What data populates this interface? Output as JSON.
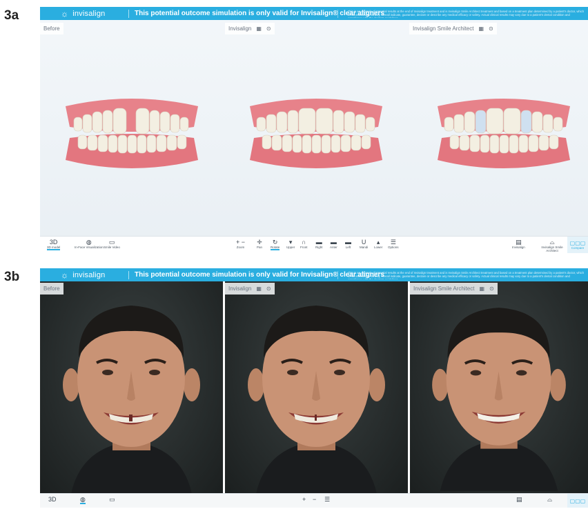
{
  "figure_labels": {
    "a": "3a",
    "b": "3b"
  },
  "banner": {
    "brand": "invisalign",
    "message": "This potential outcome simulation is only valid for Invisalign® clear aligners",
    "disclaimer": "This is an example of potential results at the end of Invisalign treatment and is Invisalign Smile Architect treatment and based on a treatment plan determined by a patient's doctor, which is not intended to convey, overall indicate, guarantee, declare or describe any medical efficacy or safety. Actual clinical results may vary due to a patient's dental condition and compliance with the doctor's guidelines."
  },
  "panel_a": {
    "views": [
      {
        "label": "Before",
        "icons": []
      },
      {
        "label": "Invisalign",
        "icons": [
          "model-icon",
          "info-icon"
        ]
      },
      {
        "label": "Invisalign Smile Architect",
        "icons": [
          "model-icon",
          "info-icon"
        ]
      }
    ],
    "left_tools": [
      {
        "icon": "3d-icon",
        "glyph": "3D",
        "label": "3D model",
        "active": true
      },
      {
        "icon": "globe-icon",
        "glyph": "◍",
        "label": "In-Face Visualization",
        "active": false
      },
      {
        "icon": "video-icon",
        "glyph": "▭",
        "label": "Smile Video",
        "active": false
      }
    ],
    "center_tools": [
      {
        "icon": "zoom-icon",
        "glyph": "+ −",
        "label": "Zoom"
      },
      {
        "icon": "pan-icon",
        "glyph": "✛",
        "label": "Pan"
      },
      {
        "icon": "rotate-icon",
        "glyph": "↻",
        "label": "Rotate"
      },
      {
        "icon": "upper-icon",
        "glyph": "▾",
        "label": "Upper"
      },
      {
        "icon": "front-icon",
        "glyph": "∩",
        "label": "Front"
      },
      {
        "icon": "right-icon",
        "glyph": "▬",
        "label": "Right"
      },
      {
        "icon": "anterior-icon",
        "glyph": "▬",
        "label": "Anter"
      },
      {
        "icon": "left-icon",
        "glyph": "▬",
        "label": "Left"
      },
      {
        "icon": "mandible-icon",
        "glyph": "U",
        "label": "Mandi"
      },
      {
        "icon": "lower-icon",
        "glyph": "▴",
        "label": "Lower"
      },
      {
        "icon": "options-icon",
        "glyph": "☰",
        "label": "Options"
      }
    ],
    "right_tools": [
      {
        "icon": "invisalign-icon",
        "glyph": "▤",
        "label": "Invisalign"
      },
      {
        "icon": "smile-architect-icon",
        "glyph": "⌓",
        "label": "Invisalign Smile Architect"
      }
    ],
    "compare": {
      "icon": "compare-icon",
      "glyph": "▢▢▢",
      "label": "Compare"
    }
  },
  "panel_b": {
    "views": [
      {
        "label": "Before",
        "icons": []
      },
      {
        "label": "Invisalign",
        "icons": [
          "model-icon",
          "info-icon"
        ]
      },
      {
        "label": "Invisalign Smile Architect",
        "icons": [
          "model-icon",
          "info-icon"
        ]
      }
    ],
    "left_tools": [
      {
        "icon": "3d-icon",
        "glyph": "3D"
      },
      {
        "icon": "globe-icon",
        "glyph": "◍"
      },
      {
        "icon": "video-icon",
        "glyph": "▭"
      }
    ],
    "center_tools": [
      {
        "icon": "zoom-in-icon",
        "glyph": "+"
      },
      {
        "icon": "zoom-out-icon",
        "glyph": "−"
      },
      {
        "icon": "options-icon",
        "glyph": "☰"
      }
    ],
    "right_tools": [
      {
        "icon": "invisalign-icon",
        "glyph": "▤"
      },
      {
        "icon": "smile-architect-icon",
        "glyph": "⌓"
      }
    ],
    "compare": {
      "icon": "compare-icon",
      "glyph": "▢▢▢"
    }
  },
  "colors": {
    "brand_blue": "#2aaee0",
    "gum": "#e7828a",
    "tooth": "#f3efe2",
    "tooth_highlight": "#cfe0f0",
    "photo_bg": "#242929"
  }
}
